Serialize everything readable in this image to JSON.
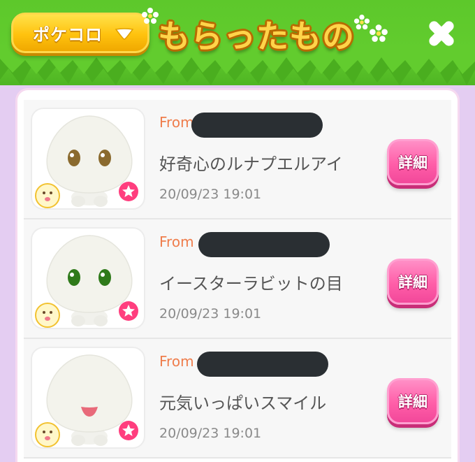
{
  "header": {
    "selector_label": "ポケコロ",
    "title": "もらったもの"
  },
  "gifts": [
    {
      "from_label": "From",
      "item_name": "好奇心のルナプエルアイ",
      "date": "20/09/23 19:01",
      "detail_label": "詳細",
      "eye_color": "#8a6a2e",
      "expression": "eyes"
    },
    {
      "from_label": "From",
      "item_name": "イースターラビットの目",
      "date": "20/09/23 19:01",
      "detail_label": "詳細",
      "eye_color": "#2f7a1a",
      "expression": "eyes"
    },
    {
      "from_label": "From",
      "item_name": "元気いっぱいスマイル",
      "date": "20/09/23 19:01",
      "detail_label": "詳細",
      "eye_color": "#e86a7a",
      "expression": "mouth"
    }
  ],
  "colors": {
    "grass": "#5dc82b",
    "background": "#e4cdf2",
    "accent_orange": "#ef7d4c",
    "detail_pink": "#ff5ea8",
    "selector_yellow": "#ffc20e"
  }
}
